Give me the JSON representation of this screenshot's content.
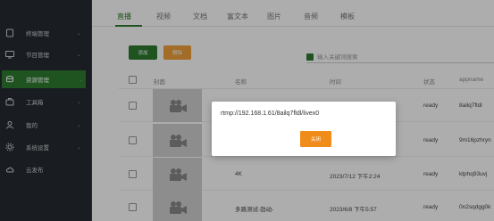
{
  "sidebar": {
    "items": [
      {
        "label": "终端管理",
        "icon": "device-icon",
        "has_chevron": true
      },
      {
        "label": "节目管理",
        "icon": "monitor-icon",
        "has_chevron": true
      },
      {
        "label": "资源管理",
        "icon": "resource-icon",
        "has_chevron": true,
        "active": true
      },
      {
        "label": "工具箱",
        "icon": "toolbox-icon",
        "has_chevron": true
      },
      {
        "label": "我的",
        "icon": "user-icon",
        "has_chevron": true
      },
      {
        "label": "系统设置",
        "icon": "settings-icon",
        "has_chevron": true
      },
      {
        "label": "云发布",
        "icon": "cloud-icon",
        "has_chevron": false
      }
    ]
  },
  "tabs": [
    {
      "label": "直播",
      "active": true
    },
    {
      "label": "视频"
    },
    {
      "label": "文档"
    },
    {
      "label": "富文本"
    },
    {
      "label": "图片"
    },
    {
      "label": "音频"
    },
    {
      "label": "模板"
    }
  ],
  "toolbar": {
    "add_label": "添加",
    "delete_label": "删除"
  },
  "search": {
    "placeholder": "输入关键词搜索",
    "value": ""
  },
  "table": {
    "headers": [
      "封面",
      "名称",
      "时间",
      "状态",
      "appname"
    ],
    "rows": [
      {
        "name": "",
        "time": "",
        "status": "ready",
        "appname": "8ailq7fldl"
      },
      {
        "name": "",
        "time": "",
        "status": "ready",
        "appname": "9m16pzhryn"
      },
      {
        "name": "4K",
        "time": "2023/7/12 下午2:24",
        "status": "ready",
        "appname": "ktphq93uvj"
      },
      {
        "name": "多路测试-劲动-",
        "time": "2023/6/8 下午5:57",
        "status": "ready",
        "appname": "0n2sqdgg0k"
      }
    ]
  },
  "modal": {
    "text": "rtmp://192.168.1.61/8ailq7fldl/livex0",
    "close_label": "关闭"
  },
  "colors": {
    "primary": "#2f7d32",
    "warning": "#f0a03a",
    "sidebar_bg": "#262c31",
    "modal_button": "#f08c1a"
  }
}
